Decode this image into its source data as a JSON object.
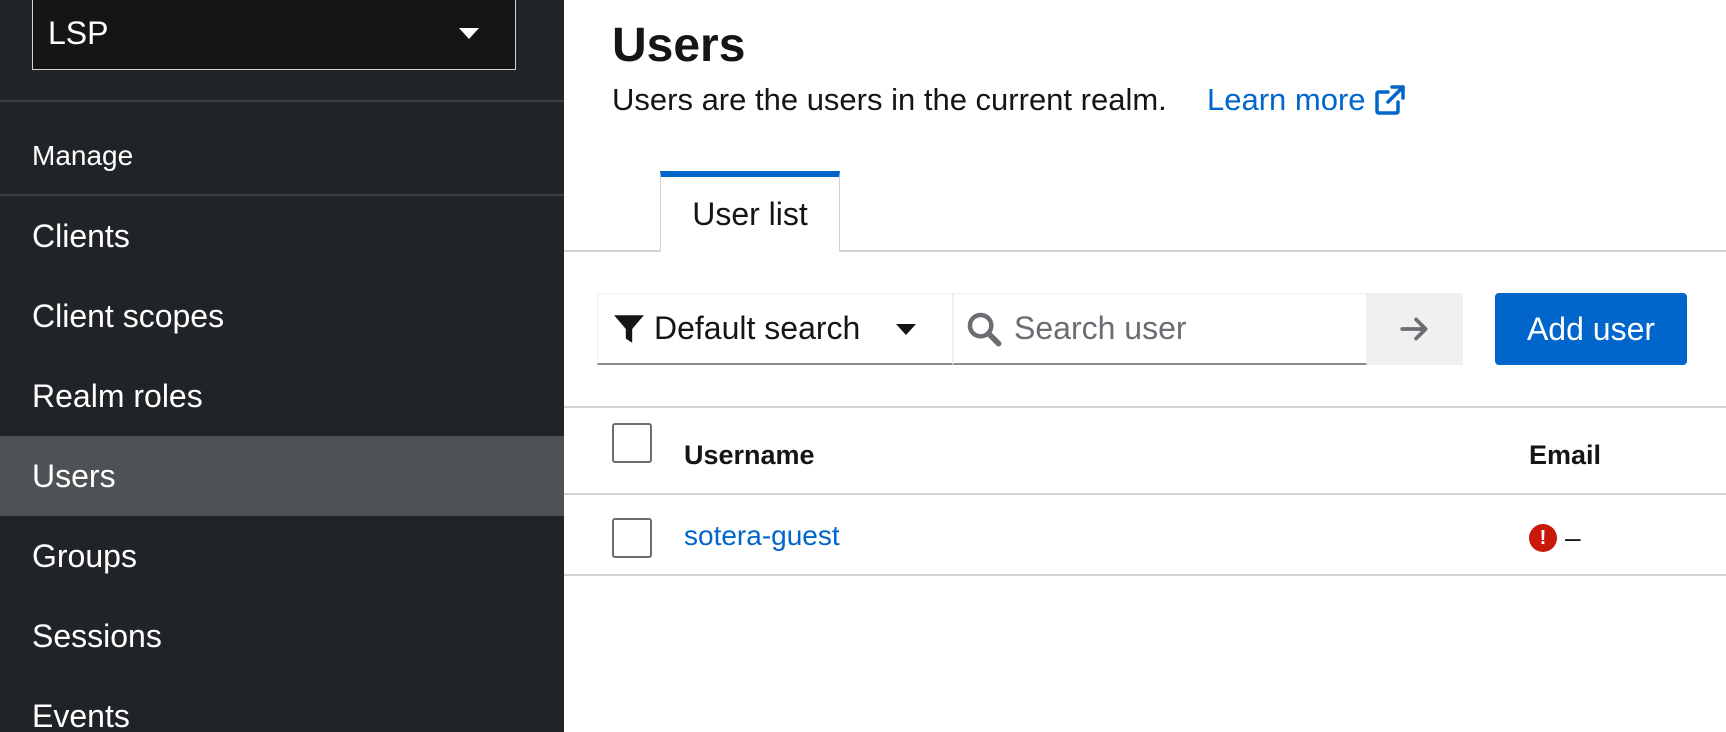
{
  "realm_selector": {
    "value": "LSP"
  },
  "sidebar": {
    "section_label": "Manage",
    "items": [
      {
        "label": "Clients"
      },
      {
        "label": "Client scopes"
      },
      {
        "label": "Realm roles"
      },
      {
        "label": "Users"
      },
      {
        "label": "Groups"
      },
      {
        "label": "Sessions"
      },
      {
        "label": "Events"
      }
    ],
    "active_item": "Users"
  },
  "page": {
    "title": "Users",
    "description": "Users are the users in the current realm.",
    "learn_more": "Learn more"
  },
  "tabs": [
    {
      "label": "User list"
    }
  ],
  "toolbar": {
    "filter_value": "Default search",
    "search_placeholder": "Search user",
    "add_button": "Add user"
  },
  "table": {
    "columns": [
      "Username",
      "Email"
    ],
    "rows": [
      {
        "username": "sotera-guest",
        "email": "–",
        "email_status_icon": "exclamation-circle-icon"
      }
    ]
  },
  "colors": {
    "sidebar_bg": "#212427",
    "active_item_bg": "#4f5255",
    "primary": "#0066cc",
    "danger": "#c9190b"
  }
}
